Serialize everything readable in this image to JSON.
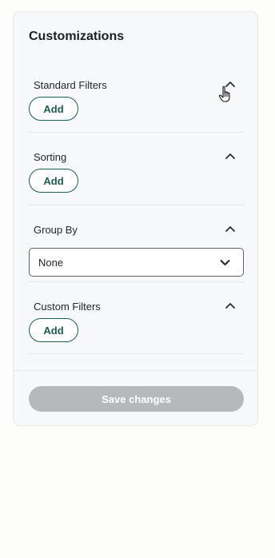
{
  "panel": {
    "title": "Customizations",
    "sections": [
      {
        "label": "Standard Filters",
        "action_label": "Add",
        "expanded": true
      },
      {
        "label": "Sorting",
        "action_label": "Add",
        "expanded": true
      },
      {
        "label": "Group By",
        "select_value": "None",
        "expanded": true
      },
      {
        "label": "Custom Filters",
        "action_label": "Add",
        "expanded": true
      }
    ],
    "save_label": "Save changes",
    "save_enabled": false
  },
  "icons": {
    "section_toggle": "chevron-up-icon",
    "select_toggle": "chevron-down-icon",
    "cursor": "hand-pointer-cursor"
  },
  "colors": {
    "accent": "#1e5b4e",
    "panel_background": "#f7f8fa",
    "disabled_button": "#b6b8bc"
  }
}
